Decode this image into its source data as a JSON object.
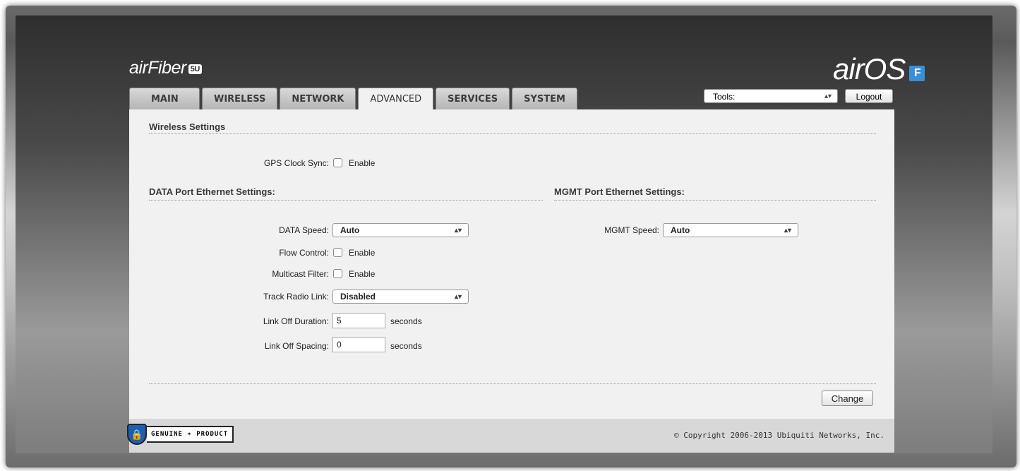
{
  "brand": {
    "left_logo": "airFiber",
    "left_badge": "5U",
    "right_logo": "airOS",
    "right_badge": "F"
  },
  "tabs": [
    {
      "label": "MAIN"
    },
    {
      "label": "WIRELESS"
    },
    {
      "label": "NETWORK"
    },
    {
      "label": "ADVANCED",
      "active": true
    },
    {
      "label": "SERVICES"
    },
    {
      "label": "SYSTEM"
    }
  ],
  "toolbar": {
    "tools_value": "Tools:",
    "logout_label": "Logout"
  },
  "wireless": {
    "title": "Wireless Settings",
    "gps_label": "GPS Clock Sync:",
    "gps_enable": "Enable"
  },
  "data_port": {
    "title": "DATA Port Ethernet Settings:",
    "speed_label": "DATA Speed:",
    "speed_value": "Auto",
    "flow_label": "Flow Control:",
    "flow_enable": "Enable",
    "multicast_label": "Multicast Filter:",
    "multicast_enable": "Enable",
    "track_label": "Track Radio Link:",
    "track_value": "Disabled",
    "off_duration_label": "Link Off Duration:",
    "off_duration_value": "5",
    "off_duration_unit": "seconds",
    "off_spacing_label": "Link Off Spacing:",
    "off_spacing_value": "0",
    "off_spacing_unit": "seconds"
  },
  "mgmt_port": {
    "title": "MGMT Port Ethernet Settings:",
    "speed_label": "MGMT Speed:",
    "speed_value": "Auto"
  },
  "actions": {
    "change_label": "Change"
  },
  "footer": {
    "genuine_left": "GENUINE",
    "genuine_right": "PRODUCT",
    "copyright": "© Copyright 2006-2013 Ubiquiti Networks, Inc."
  }
}
